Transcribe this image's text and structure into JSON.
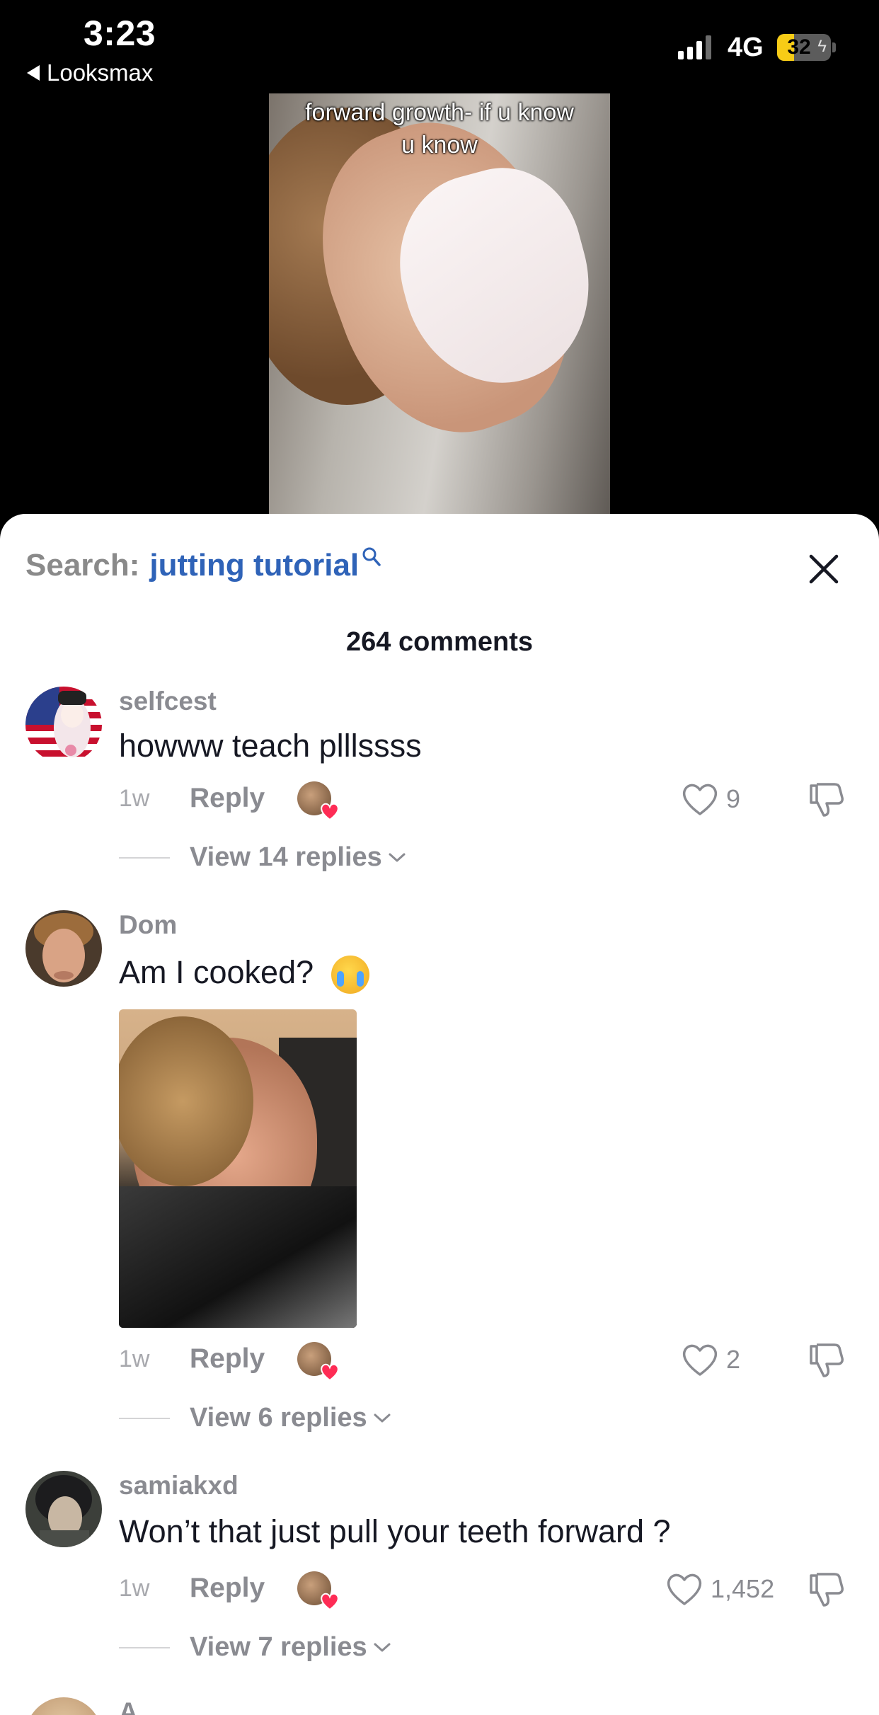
{
  "status_bar": {
    "time": "3:23",
    "back_app": "Looksmax",
    "network": "4G",
    "battery": "32",
    "battery_level": 0.32
  },
  "video": {
    "caption": "forward growth- if u know u know"
  },
  "sheet": {
    "search_label": "Search:",
    "search_term": "jutting tutorial",
    "comment_count": "264 comments"
  },
  "comments": [
    {
      "username": "selfcest",
      "text": "howww teach plllssss",
      "time": "1w",
      "reply_label": "Reply",
      "likes": "9",
      "view_replies": "View 14 replies"
    },
    {
      "username": "Dom",
      "text": "Am I cooked?",
      "time": "1w",
      "reply_label": "Reply",
      "likes": "2",
      "view_replies": "View 6 replies"
    },
    {
      "username": "samiakxd",
      "text": "Won’t that just pull your teeth forward ?",
      "time": "1w",
      "reply_label": "Reply",
      "likes": "1,452",
      "view_replies": "View 7 replies"
    }
  ],
  "next_comment": {
    "username_partial": "A"
  },
  "icons": {
    "search": "search-icon",
    "close": "close-icon",
    "like": "heart-outline-icon",
    "dislike": "thumbs-down-icon",
    "creator_liked": "creator-heart-icon",
    "chevron": "chevron-down-icon"
  },
  "colors": {
    "search_term": "#2f63b8",
    "heart": "#fe2c55",
    "battery": "#f7cc16"
  }
}
